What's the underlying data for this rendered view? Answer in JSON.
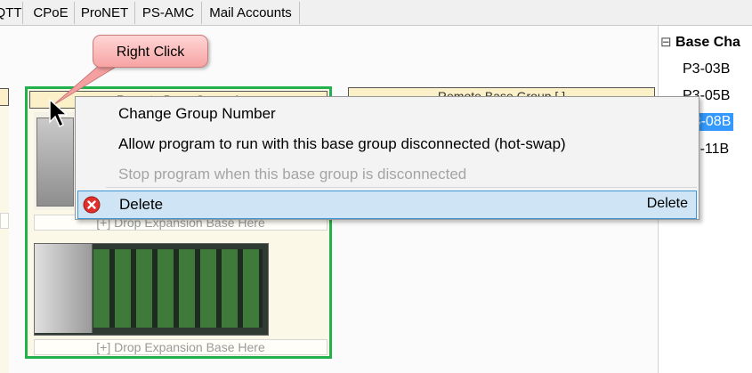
{
  "tabs": [
    "QTT",
    "CPoE",
    "ProNET",
    "PS-AMC",
    "Mail Accounts"
  ],
  "callout": {
    "text": "Right Click"
  },
  "groups": {
    "left_header": "",
    "main_header": "Remote Base Group 1",
    "right_header": "Remote Base Group [ ]",
    "drop_here": "[+] Drop Expansion Base Here"
  },
  "context_menu": {
    "items": [
      {
        "label": "Change Group Number",
        "enabled": true
      },
      {
        "label": "Allow program to run with this base group disconnected (hot-swap)",
        "enabled": true
      },
      {
        "label": "Stop program when this base group is disconnected",
        "enabled": false
      }
    ],
    "delete": {
      "label": "Delete",
      "shortcut": "Delete",
      "icon": "delete-x-icon"
    }
  },
  "base_tree": {
    "header": "Base Cha",
    "collapse_glyph": "⊟",
    "items": [
      "P3-03B",
      "P3-05B",
      "P3-08B",
      "P3-11B"
    ],
    "selected_index": 2
  },
  "colors": {
    "group_border_selected": "#22b14c",
    "menu_highlight": "#cfe5f6",
    "callout_fill": "#f7a3a3",
    "tree_selected": "#3399ff"
  }
}
